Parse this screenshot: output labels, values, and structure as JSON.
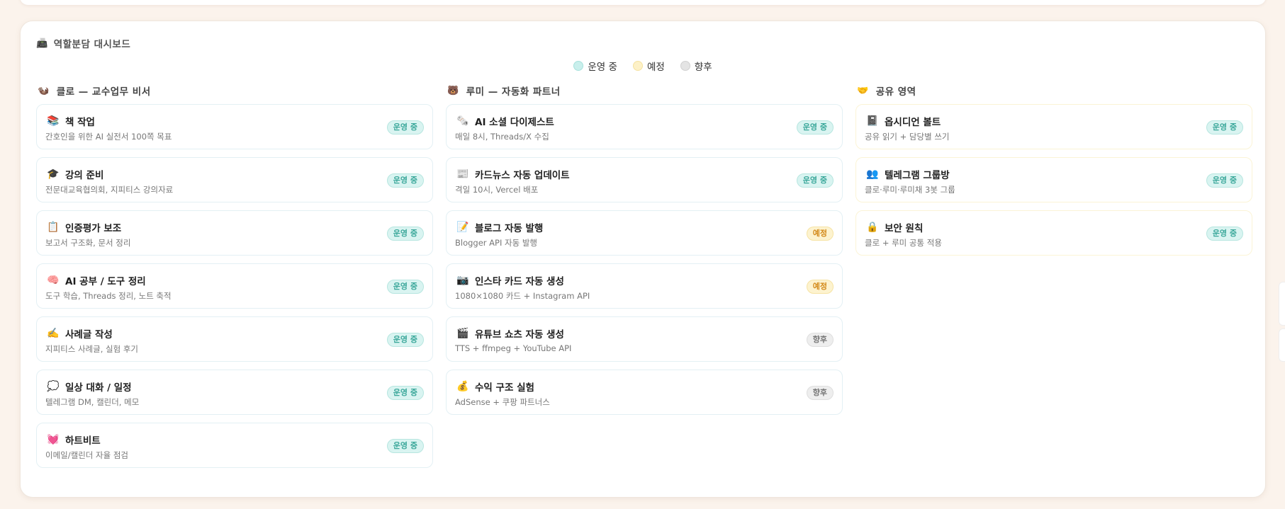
{
  "dashboard": {
    "title": "역할분담 대시보드",
    "title_icon": "📠",
    "legend": [
      {
        "label": "운영 중",
        "status": "op"
      },
      {
        "label": "예정",
        "status": "pl"
      },
      {
        "label": "향후",
        "status": "fu"
      }
    ]
  },
  "status_colors": {
    "operating": "#3aa79a",
    "planned": "#d38a1a",
    "future": "#777777"
  },
  "columns": [
    {
      "title": "클로 — 교수업무 비서",
      "icon": "🦦",
      "cards": [
        {
          "icon": "📚",
          "title": "책 작업",
          "sub": "간호인을 위한 AI 실전서 100쪽 목표",
          "badge": "운영 중",
          "status": "op"
        },
        {
          "icon": "🎓",
          "title": "강의 준비",
          "sub": "전문대교육협의회, 지피티스 강의자료",
          "badge": "운영 중",
          "status": "op"
        },
        {
          "icon": "📋",
          "title": "인증평가 보조",
          "sub": "보고서 구조화, 문서 정리",
          "badge": "운영 중",
          "status": "op"
        },
        {
          "icon": "🧠",
          "title": "AI 공부 / 도구 정리",
          "sub": "도구 학습, Threads 정리, 노트 축적",
          "badge": "운영 중",
          "status": "op"
        },
        {
          "icon": "✍️",
          "title": "사례글 작성",
          "sub": "지피티스 사례글, 실험 후기",
          "badge": "운영 중",
          "status": "op"
        },
        {
          "icon": "💭",
          "title": "일상 대화 / 일정",
          "sub": "텔레그램 DM, 캘린더, 메모",
          "badge": "운영 중",
          "status": "op"
        },
        {
          "icon": "💓",
          "title": "하트비트",
          "sub": "이메일/캘린더 자율 점검",
          "badge": "운영 중",
          "status": "op"
        }
      ]
    },
    {
      "title": "루미 — 자동화 파트너",
      "icon": "🐻",
      "cards": [
        {
          "icon": "🗞️",
          "title": "AI 소셜 다이제스트",
          "sub": "매일 8시, Threads/X 수집",
          "badge": "운영 중",
          "status": "op"
        },
        {
          "icon": "📰",
          "title": "카드뉴스 자동 업데이트",
          "sub": "격일 10시, Vercel 배포",
          "badge": "운영 중",
          "status": "op"
        },
        {
          "icon": "📝",
          "title": "블로그 자동 발행",
          "sub": "Blogger API 자동 발행",
          "badge": "예정",
          "status": "pl"
        },
        {
          "icon": "📷",
          "title": "인스타 카드 자동 생성",
          "sub": "1080×1080 카드 + Instagram API",
          "badge": "예정",
          "status": "pl"
        },
        {
          "icon": "🎬",
          "title": "유튜브 쇼츠 자동 생성",
          "sub": "TTS + ffmpeg + YouTube API",
          "badge": "향후",
          "status": "fu"
        },
        {
          "icon": "💰",
          "title": "수익 구조 실험",
          "sub": "AdSense + 쿠팡 파트너스",
          "badge": "향후",
          "status": "fu"
        }
      ]
    },
    {
      "title": "공유 영역",
      "icon": "🤝",
      "cards": [
        {
          "icon": "📓",
          "title": "옵시디언 볼트",
          "sub": "공유 읽기 + 담당별 쓰기",
          "badge": "운영 중",
          "status": "op"
        },
        {
          "icon": "👥",
          "title": "텔레그램 그룹방",
          "sub": "클로·루미·루미채 3봇 그룹",
          "badge": "운영 중",
          "status": "op"
        },
        {
          "icon": "🔒",
          "title": "보안 원칙",
          "sub": "클로 + 루미 공통 적용",
          "badge": "운영 중",
          "status": "op"
        }
      ]
    }
  ]
}
